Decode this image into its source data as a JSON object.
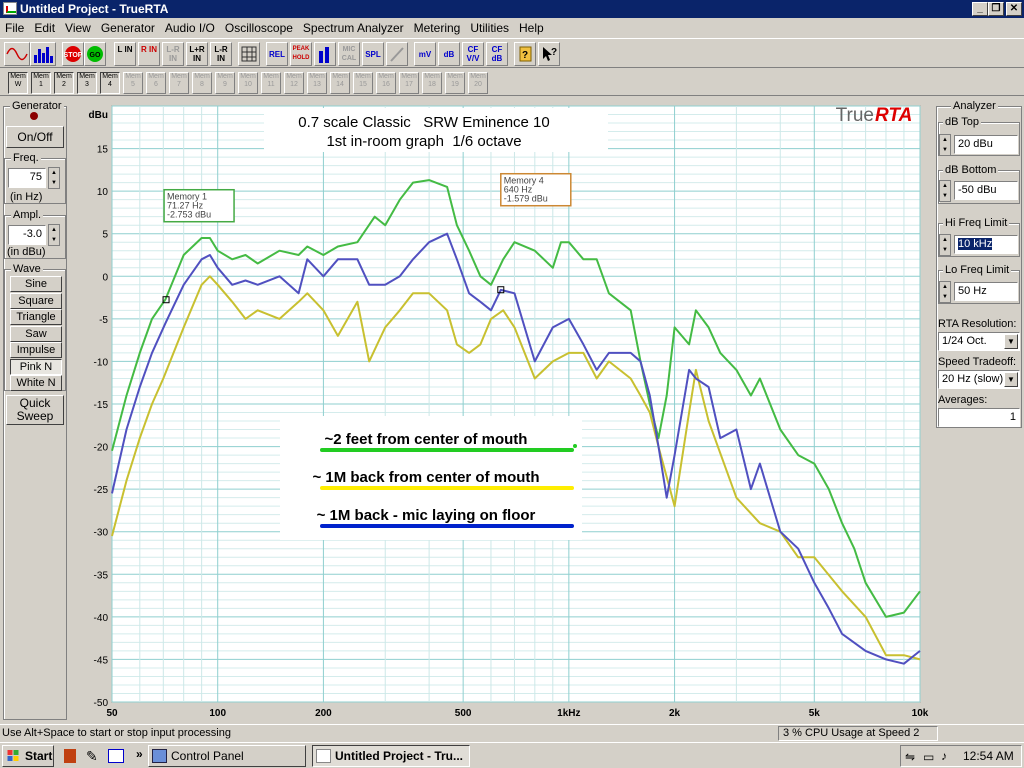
{
  "window": {
    "title": "Untitled Project - TrueRTA"
  },
  "menu": [
    "File",
    "Edit",
    "View",
    "Generator",
    "Audio I/O",
    "Oscilloscope",
    "Spectrum Analyzer",
    "Metering",
    "Utilities",
    "Help"
  ],
  "toolbar": {
    "stop": "STOP",
    "go": "GO",
    "l_in": "L IN",
    "r_in": "R IN",
    "lr_in": "L-R IN",
    "lpr_in": "L+R IN",
    "lmr_in": "L-R IN",
    "rel": "REL",
    "peak_hold": "PEAK HOLD",
    "mic_cal": "MIC CAL",
    "spl": "SPL",
    "mv": "mV",
    "db": "dB",
    "cf_vv": "CF V/V",
    "cf_db": "CF dB",
    "help": "?"
  },
  "memories": [
    "Mem W",
    "Mem 1",
    "Mem 2",
    "Mem 3",
    "Mem 4",
    "Mem 5",
    "Mem 6",
    "Mem 7",
    "Mem 8",
    "Mem 9",
    "Mem 10",
    "Mem 11",
    "Mem 12",
    "Mem 13",
    "Mem 14",
    "Mem 15",
    "Mem 16",
    "Mem 17",
    "Mem 18",
    "Mem 19",
    "Mem 20"
  ],
  "generator": {
    "title": "Generator",
    "on_off": "On/Off",
    "freq_label": "Freq.",
    "freq_value": "75",
    "freq_unit": "(in Hz)",
    "ampl_label": "Ampl.",
    "ampl_value": "-3.0",
    "ampl_unit": "(in dBu)",
    "wave_label": "Wave",
    "waves": [
      "Sine",
      "Square",
      "Triangle",
      "Saw",
      "Impulse",
      "Pink N",
      "White N"
    ],
    "quick_sweep": "Quick Sweep"
  },
  "analyzer": {
    "title": "Analyzer",
    "db_top_label": "dB Top",
    "db_top": "20 dBu",
    "db_bottom_label": "dB Bottom",
    "db_bottom": "-50 dBu",
    "hi_freq_label": "Hi Freq Limit",
    "hi_freq": "10 kHz",
    "lo_freq_label": "Lo Freq Limit",
    "lo_freq": "50 Hz",
    "resolution_label": "RTA Resolution:",
    "resolution": "1/24 Oct.",
    "speed_label": "Speed Tradeoff:",
    "speed": "20 Hz (slow)",
    "averages_label": "Averages:",
    "averages": "1"
  },
  "status": {
    "hint": "Use Alt+Space to start or stop input processing",
    "cpu": "3 % CPU Usage at Speed 2"
  },
  "taskbar": {
    "start": "Start",
    "control_panel": "Control Panel",
    "active": "Untitled Project - Tru...",
    "clock": "12:54 AM"
  },
  "colors": {
    "green": "#44bb44",
    "yellow": "#c8c030",
    "blue": "#5050c0",
    "memo1_border": "#44aa44",
    "memo4_border": "#cc8833"
  },
  "chart_data": {
    "type": "line",
    "title": "0.7 scale Classic   SRW Eminence 10",
    "subtitle": "1st in-room graph  1/6 octave",
    "logo_true": "True",
    "logo_rta": "RTA",
    "ylabel": "dBu",
    "ylim": [
      -50,
      20
    ],
    "xlim": [
      50,
      10000
    ],
    "xscale": "log",
    "y_ticks": [
      "15",
      "10",
      "5",
      "0",
      "-5",
      "-10",
      "-15",
      "-20",
      "-25",
      "-30",
      "-35",
      "-40",
      "-45",
      "-50"
    ],
    "x_ticks": [
      {
        "v": 50,
        "t": "50"
      },
      {
        "v": 100,
        "t": "100"
      },
      {
        "v": 200,
        "t": "200"
      },
      {
        "v": 500,
        "t": "500"
      },
      {
        "v": 1000,
        "t": "1kHz"
      },
      {
        "v": 2000,
        "t": "2k"
      },
      {
        "v": 5000,
        "t": "5k"
      },
      {
        "v": 10000,
        "t": "10k"
      }
    ],
    "series": [
      {
        "name": "~2 feet from center of mouth",
        "color": "#44bb44",
        "x": [
          50,
          55,
          60,
          65,
          71,
          80,
          90,
          95,
          100,
          110,
          120,
          130,
          150,
          170,
          180,
          200,
          220,
          250,
          280,
          300,
          330,
          360,
          400,
          450,
          480,
          520,
          560,
          600,
          650,
          700,
          800,
          900,
          950,
          1000,
          1100,
          1200,
          1300,
          1500,
          1600,
          1700,
          1800,
          1900,
          2000,
          2200,
          2300,
          2500,
          2700,
          3000,
          3300,
          3500,
          4000,
          4500,
          5000,
          5500,
          6000,
          6500,
          7000,
          8000,
          9000,
          10000
        ],
        "y": [
          -20.5,
          -14,
          -9,
          -5,
          -2.7,
          2.5,
          4.5,
          4.5,
          3,
          2,
          2.5,
          1.5,
          3,
          2.5,
          3.5,
          2.5,
          3.5,
          4,
          7,
          6,
          9,
          11,
          11.3,
          10.5,
          6,
          3,
          0,
          -1,
          2,
          4,
          3,
          1,
          4,
          4,
          2,
          2,
          -2,
          -4,
          -10,
          -15,
          -19,
          -14,
          -6,
          -8,
          -4,
          -6,
          -9,
          -11,
          -14,
          -12,
          -18,
          -21,
          -22,
          -25,
          -29,
          -32,
          -36,
          -40,
          -39.5,
          -37
        ]
      },
      {
        "name": "~ 1M back from center of mouth",
        "color": "#c8c030",
        "x": [
          50,
          55,
          60,
          65,
          70,
          80,
          90,
          95,
          100,
          110,
          120,
          130,
          150,
          170,
          180,
          200,
          220,
          250,
          270,
          300,
          330,
          360,
          400,
          450,
          480,
          520,
          560,
          600,
          650,
          700,
          800,
          900,
          1000,
          1100,
          1200,
          1300,
          1500,
          1600,
          1700,
          1800,
          2000,
          2200,
          2300,
          2500,
          3000,
          3500,
          4000,
          4500,
          5000,
          6000,
          7000,
          8000,
          9000,
          10000
        ],
        "y": [
          -30.5,
          -24,
          -19,
          -15,
          -12,
          -6,
          -1,
          0,
          -1,
          -3,
          -5,
          -4,
          -5,
          -3,
          -2,
          -4,
          -7,
          -3,
          -10,
          -6,
          -4,
          -2,
          -2,
          -4,
          -8,
          -9,
          -8,
          -5,
          -4,
          -6,
          -12,
          -10,
          -9,
          -9,
          -12,
          -10,
          -12,
          -14,
          -16,
          -20,
          -27,
          -16,
          -11,
          -17,
          -26,
          -29,
          -30,
          -33,
          -33,
          -37,
          -40,
          -44.5,
          -44.5,
          -45
        ]
      },
      {
        "name": "~ 1M back - mic laying on floor",
        "color": "#5050c0",
        "x": [
          50,
          55,
          60,
          65,
          71,
          80,
          90,
          95,
          100,
          110,
          120,
          130,
          150,
          170,
          180,
          200,
          220,
          250,
          270,
          300,
          330,
          360,
          400,
          450,
          480,
          520,
          560,
          600,
          640,
          700,
          800,
          900,
          1000,
          1100,
          1200,
          1300,
          1400,
          1500,
          1600,
          1700,
          1800,
          1900,
          2000,
          2200,
          2300,
          2500,
          2700,
          3000,
          3300,
          3500,
          4000,
          4500,
          5000,
          5500,
          6000,
          7000,
          8000,
          9000,
          10000
        ],
        "y": [
          -25.5,
          -18,
          -13,
          -9,
          -5.5,
          -1,
          2,
          2.5,
          1,
          -1,
          -0.5,
          -1,
          0,
          -2,
          2,
          0,
          2,
          2,
          -1,
          -1,
          0,
          2,
          4,
          5,
          2,
          -2,
          -3,
          -4,
          -1.6,
          -2,
          -10,
          -6,
          -5,
          -8,
          -11,
          -9,
          -9,
          -9,
          -10,
          -14,
          -20,
          -26,
          -21,
          -11,
          -12,
          -13,
          -19,
          -18,
          -25,
          -22,
          -30,
          -32,
          -36,
          -39,
          -42,
          -44,
          -45,
          -45.5,
          -44
        ]
      }
    ],
    "annotations": [
      {
        "lines": [
          "Memory 1",
          "71.27 Hz",
          "-2.753 dBu"
        ],
        "x": 71.27,
        "y": -2.753,
        "color": "#44aa44"
      },
      {
        "lines": [
          "Memory 4",
          "640 Hz",
          "-1.579 dBu"
        ],
        "x": 640,
        "y": -1.579,
        "color": "#cc8833"
      }
    ],
    "legend": [
      {
        "text": "~2 feet from center of mouth",
        "color": "#22cc22"
      },
      {
        "text": "~ 1M back from center of mouth",
        "color": "#ffee00"
      },
      {
        "text": "~ 1M back - mic laying on floor",
        "color": "#0022cc"
      }
    ]
  }
}
